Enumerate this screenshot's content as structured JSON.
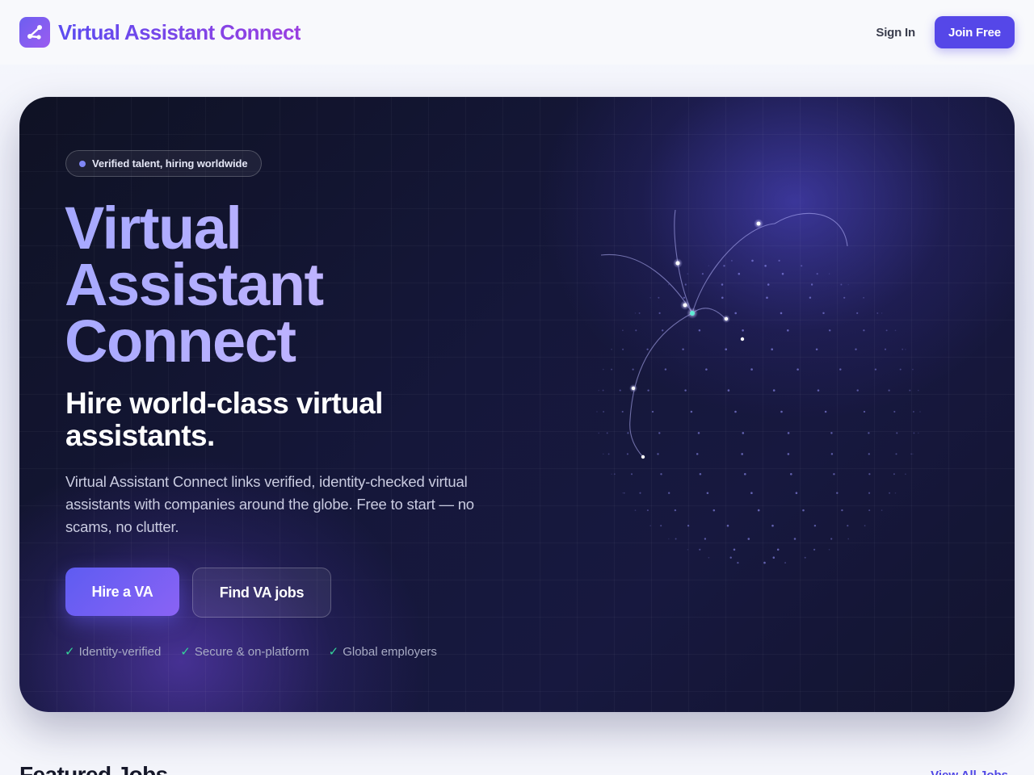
{
  "header": {
    "brand_name": "Virtual Assistant Connect",
    "sign_in_label": "Sign In",
    "join_label": "Join Free"
  },
  "hero": {
    "badge": "Verified talent, hiring worldwide",
    "title_lines": [
      "Virtual",
      "Assistant",
      "Connect"
    ],
    "subtitle": "Hire world-class virtual assistants.",
    "description": "Virtual Assistant Connect links verified, identity-checked virtual assistants with companies around the globe. Free to start — no scams, no clutter.",
    "primary_button": "Hire a VA",
    "secondary_button": "Find VA jobs",
    "checks": [
      "Identity-verified",
      "Secure & on-platform",
      "Global employers"
    ]
  },
  "featured": {
    "title": "Featured Jobs",
    "view_all": "View All Jobs"
  },
  "colors": {
    "accent": "#5547e8",
    "hero_bg": "#15173a",
    "check": "#34d399"
  }
}
